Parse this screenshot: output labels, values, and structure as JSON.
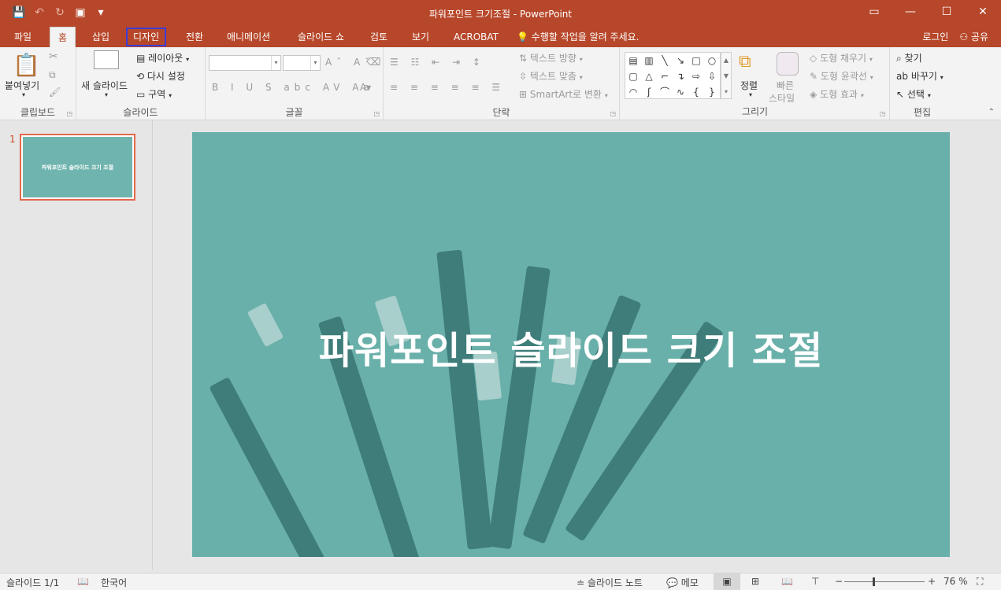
{
  "window": {
    "title": "파워포인트 크기조절 - PowerPoint"
  },
  "tabs": [
    {
      "label": "파일"
    },
    {
      "label": "홈"
    },
    {
      "label": "삽입"
    },
    {
      "label": "디자인"
    },
    {
      "label": "전환"
    },
    {
      "label": "애니메이션"
    },
    {
      "label": "슬라이드 쇼"
    },
    {
      "label": "검토"
    },
    {
      "label": "보기"
    },
    {
      "label": "ACROBAT"
    }
  ],
  "tellme": "수행할 작업을 알려 주세요.",
  "account": {
    "login": "로그인",
    "share": "공유"
  },
  "ribbon": {
    "clipboard": {
      "label": "클립보드",
      "paste": "붙여넣기"
    },
    "slides": {
      "label": "슬라이드",
      "new_slide": "새 슬라이드",
      "layout": "레이아웃",
      "reset": "다시 설정",
      "section": "구역"
    },
    "font": {
      "label": "글꼴"
    },
    "paragraph": {
      "label": "단락",
      "text_direction": "텍스트 방향",
      "align_text": "텍스트 맞춤",
      "smartart": "SmartArt로 변환"
    },
    "drawing": {
      "label": "그리기",
      "arrange": "정렬",
      "quick_styles_1": "빠른",
      "quick_styles_2": "스타일",
      "shape_fill": "도형 채우기",
      "shape_outline": "도형 윤곽선",
      "shape_effects": "도형 효과"
    },
    "editing": {
      "label": "편집",
      "find": "찾기",
      "replace": "바꾸기",
      "select": "선택"
    }
  },
  "thumbnails": [
    {
      "number": "1",
      "title": "파워포인트 슬라이드 크기 조절"
    }
  ],
  "slide": {
    "title": "파워포인트 슬라이드 크기 조절"
  },
  "status": {
    "slide_info": "슬라이드 1/1",
    "language": "한국어",
    "notes": "슬라이드 노트",
    "comments": "메모",
    "zoom": "76 %"
  },
  "colors": {
    "accent": "#b7472a",
    "slide_bg": "#6ab0aa",
    "highlight_box": "#3d3dd6"
  }
}
